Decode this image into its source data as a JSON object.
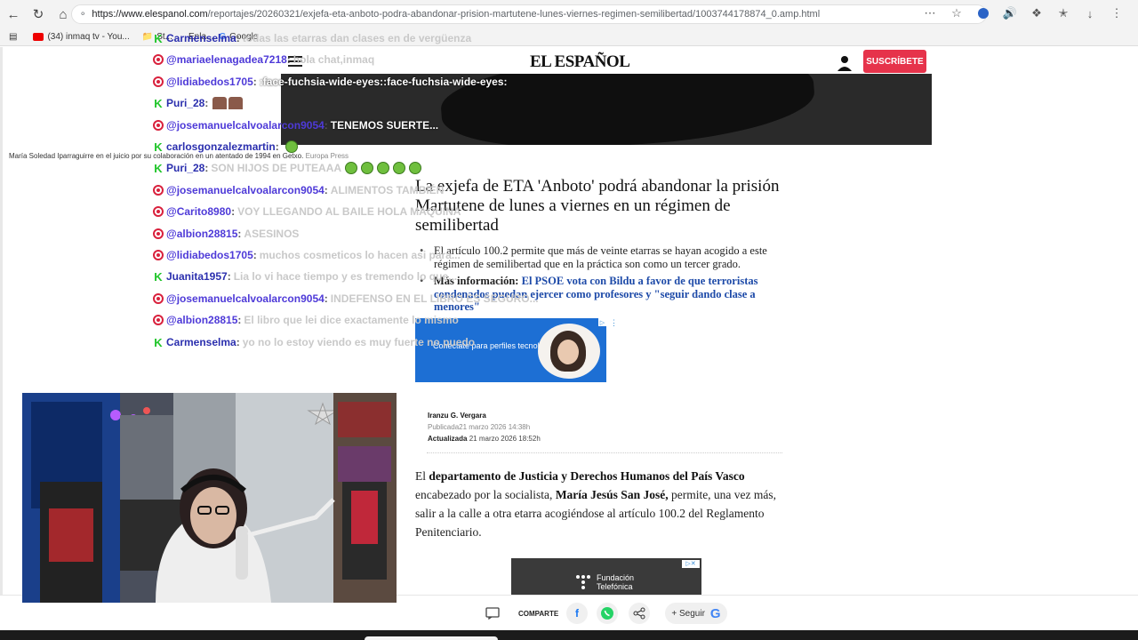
{
  "browser": {
    "url_host": "https://www.elespanol.com",
    "url_path": "/reportajes/20260321/exjefa-eta-anboto-podra-abandonar-prision-martutene-lunes-viernes-regimen-semilibertad/1003744178874_0.amp.html",
    "bookmarks": [
      {
        "label": "(34) inmaq tv - You..."
      },
      {
        "label": "St..."
      },
      {
        "label": "Enla..."
      },
      {
        "label": "Google"
      }
    ]
  },
  "site": {
    "logo": "EL ESPAÑOL",
    "subscribe_label": "SUSCRÍBETE",
    "photo_caption": "María Soledad Iparraguirre en el juicio por su colaboración en un atentado de 1994 en Getxo.",
    "photo_agency": "Europa Press"
  },
  "article": {
    "headline": "La exjefa de ETA 'Anboto' podrá abandonar la prisión Martutene de lunes a viernes en un régimen de semilibertad",
    "bullet1": "El artículo 100.2 permite que más de veinte etarras se hayan acogido a este régimen de semilibertad que en la práctica son como un tercer grado.",
    "bullet2_prefix": "Más información:",
    "bullet2_link": "El PSOE vota con Bildu a favor de que terroristas condenados puedan ejercer como profesores y \"seguir dando clase a menores\"",
    "ad1_text": "Conéctate para perfiles tecnológicos",
    "author": "Iranzu G. Vergara",
    "published_label": "Publicada",
    "published_date": "21 marzo 2026  14:38h",
    "updated_label": "Actualizada",
    "updated_date": "21 marzo 2026  18:52h",
    "body": {
      "p1": "El ",
      "b1": "departamento de Justicia y Derechos Humanos del País Vasco",
      "p2": " encabezado por la socialista, ",
      "b2": "María Jesús San José,",
      "p3": " permite, una vez más, salir a la calle a otra etarra acogiéndose al artículo 100.2 del Reglamento Penitenciario."
    },
    "ad2_text": "Fundación Telefónica"
  },
  "sharebar": {
    "share_label": "COMPARTE",
    "follow_label": "+ Seguir"
  },
  "chat": [
    {
      "platform": "kick",
      "user": "Carmenselma",
      "text": "todas las etarras dan clases en de vergüenza",
      "tone": "light"
    },
    {
      "platform": "youtube",
      "user": "@mariaelenagadea7218",
      "text": "hola chat,inmaq",
      "tone": "light"
    },
    {
      "platform": "youtube",
      "user": "@lidiabedos1705",
      "text": ":face-fuchsia-wide-eyes::face-fuchsia-wide-eyes:",
      "tone": "dark"
    },
    {
      "platform": "kick",
      "user": "Puri_28",
      "text": "",
      "tone": "light"
    },
    {
      "platform": "youtube",
      "user": "@josemanuelcalvoalarcon9054",
      "text": "TENEMOS SUERTE...",
      "tone": "dark"
    },
    {
      "platform": "kick",
      "user": "carlosgonzalezmartin",
      "text": "",
      "tone": "light"
    },
    {
      "platform": "kick",
      "user": "Puri_28",
      "text": "SON HIJOS DE PUTEAAA",
      "tone": "light"
    },
    {
      "platform": "youtube",
      "user": "@josemanuelcalvoalarcon9054",
      "text": "ALIMENTOS TAMBIÉN",
      "tone": "light"
    },
    {
      "platform": "youtube",
      "user": "@Carito8980",
      "text": "VOY LLEGANDO AL BAILE HOLA MAQUINA",
      "tone": "light"
    },
    {
      "platform": "youtube",
      "user": "@albion28815",
      "text": "ASESINOS",
      "tone": "light"
    },
    {
      "platform": "youtube",
      "user": "@lidiabedos1705",
      "text": "muchos cosmeticos lo hacen asi para...",
      "tone": "light"
    },
    {
      "platform": "kick",
      "user": "Juanita1957",
      "text": "Lia lo vi hace tiempo y es tremendo lo que...",
      "tone": "light"
    },
    {
      "platform": "youtube",
      "user": "@josemanuelcalvoalarcon9054",
      "text": "INDEFENSO EN EL LIBRO ES SEGURO...",
      "tone": "light"
    },
    {
      "platform": "youtube",
      "user": "@albion28815",
      "text": "El libro que lei dice exactamente lo mismo",
      "tone": "light"
    },
    {
      "platform": "kick",
      "user": "Carmenselma",
      "text": "yo no lo estoy viendo es muy fuerte no puedo",
      "tone": "light"
    }
  ]
}
